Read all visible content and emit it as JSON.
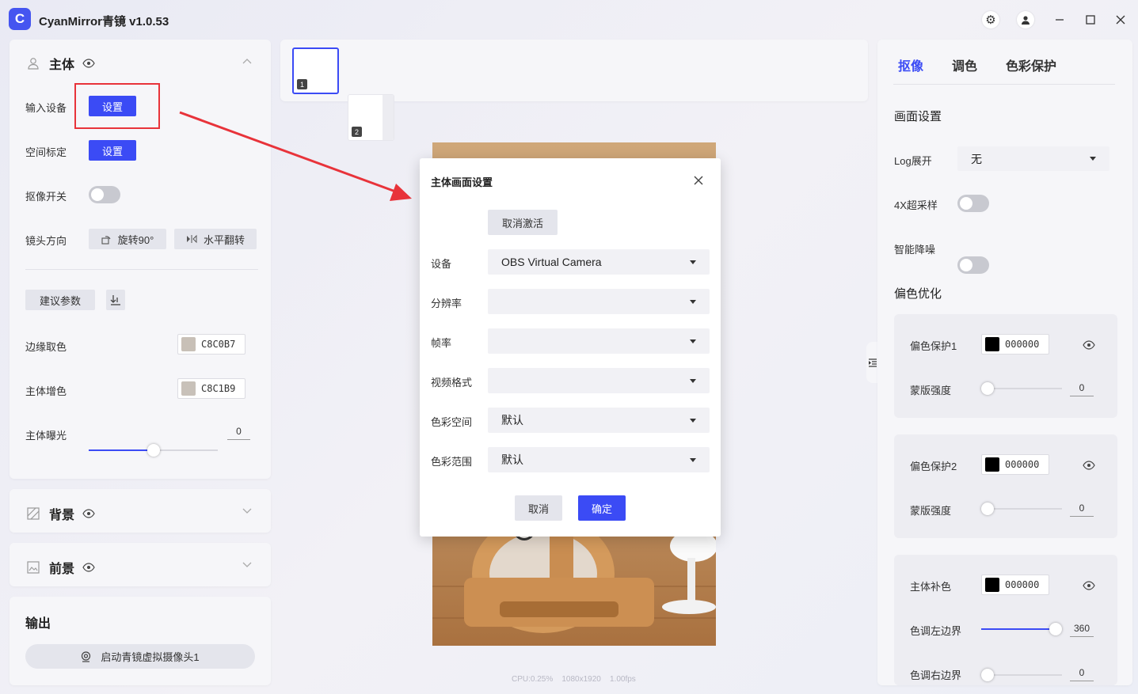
{
  "app": {
    "title": "CyanMirror青镜 v1.0.53",
    "logo_letter": "C"
  },
  "subject": {
    "title": "主体",
    "input_device_label": "输入设备",
    "input_device_button": "设置",
    "space_calib_label": "空间标定",
    "space_calib_button": "设置",
    "matting_switch_label": "抠像开关",
    "lens_direction_label": "镜头方向",
    "rotate_button": "旋转90°",
    "flip_button": "水平翻转",
    "suggest_button": "建议参数",
    "edge_color_label": "边缘取色",
    "edge_color_hex": "C8C0B7",
    "edge_color": "#c8c0b7",
    "subject_tint_label": "主体增色",
    "subject_tint_hex": "C8C1B9",
    "subject_tint_color": "#c8c1b9",
    "exposure_label": "主体曝光",
    "exposure_value": "0"
  },
  "background": {
    "title": "背景"
  },
  "foreground": {
    "title": "前景"
  },
  "output": {
    "title": "输出",
    "start_camera_button": "启动青镜虚拟摄像头1"
  },
  "thumbnails": [
    {
      "num": "1"
    },
    {
      "num": "2"
    }
  ],
  "dialog": {
    "title": "主体画面设置",
    "deactivate_button": "取消激活",
    "device_label": "设备",
    "device_value": "OBS Virtual Camera",
    "resolution_label": "分辨率",
    "resolution_value": "",
    "framerate_label": "帧率",
    "framerate_value": "",
    "video_format_label": "视频格式",
    "video_format_value": "",
    "color_space_label": "色彩空间",
    "color_space_value": "默认",
    "color_range_label": "色彩范围",
    "color_range_value": "默认",
    "cancel_button": "取消",
    "ok_button": "确定"
  },
  "right": {
    "tabs": [
      "抠像",
      "调色",
      "色彩保护"
    ],
    "frame_settings_title": "画面设置",
    "log_label": "Log展开",
    "log_value": "无",
    "supersample_label": "4X超采样",
    "denoise_label": "智能降噪",
    "color_cast_title": "偏色优化",
    "protect1_label": "偏色保护1",
    "protect1_hex": "000000",
    "mask1_label": "蒙版强度",
    "mask1_value": "0",
    "protect2_label": "偏色保护2",
    "protect2_hex": "000000",
    "mask2_label": "蒙版强度",
    "mask2_value": "0",
    "compensate_label": "主体补色",
    "compensate_hex": "000000",
    "hue_left_label": "色调左边界",
    "hue_left_value": "360",
    "hue_right_label": "色调右边界",
    "hue_right_value": "0"
  },
  "status": {
    "cpu": "CPU:0.25%",
    "resolution": "1080x1920",
    "fps": "1.00fps"
  },
  "colors": {
    "accent": "#3b4bf5",
    "highlight": "#e8333a"
  }
}
